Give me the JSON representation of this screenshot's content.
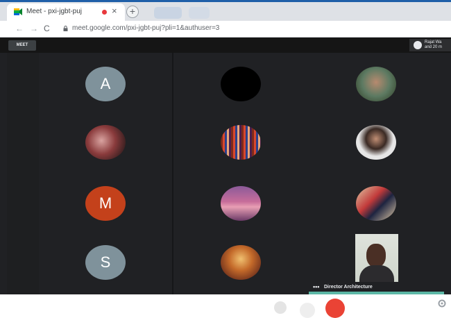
{
  "browser": {
    "tab_title": "Meet - pxi-jgbt-puj",
    "tab_close": "×",
    "new_tab": "+",
    "back": "←",
    "forward": "→",
    "reload": "C",
    "url": "meet.google.com/pxi-jgbt-puj?pli=1&authuser=3"
  },
  "meet": {
    "top_button_label": "MEET",
    "user_line1": "Rajat Wa",
    "user_line2": "and 20 m",
    "participants_letters": [
      "A",
      "M",
      "S"
    ],
    "active_speaker_name": "Director Architecture",
    "active_speaker_menu": "•••"
  },
  "colors": {
    "letter_a": "#7f929b",
    "letter_m": "#c4411b",
    "letter_s": "#7f929b",
    "end_call": "#ea4335"
  },
  "icons": [
    "browser-favicon",
    "lock-icon",
    "gear-icon",
    "options-dots-icon"
  ]
}
